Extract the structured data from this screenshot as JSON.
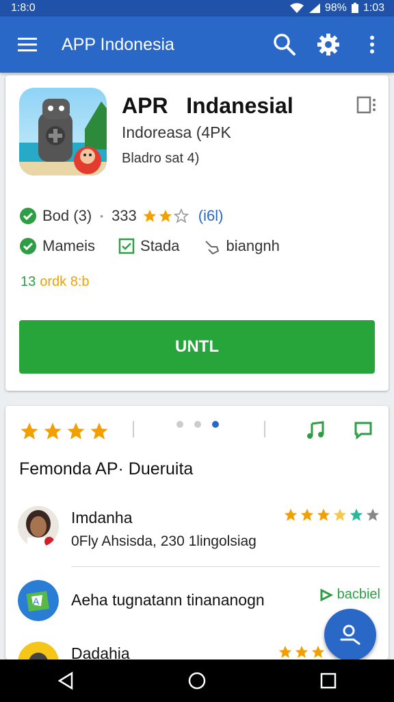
{
  "status": {
    "time": "1:8:0",
    "battery": "98%",
    "clock": "1:03"
  },
  "app_bar": {
    "title": "APP Indonesia"
  },
  "app": {
    "name": "APR   Indanesial",
    "subtitle": "Indoreasa  (4PK",
    "meta": "Bladro sat 4)",
    "info_a": "Bod (3)",
    "rating_value": "333",
    "rating_count": "(i6l)",
    "info_b": "Mameis",
    "info_c": "Stada",
    "info_d": "biangnh",
    "size_green": "13",
    "size_orange": "ordk 8:b",
    "install_label": "UNTL"
  },
  "reviews": {
    "heading": "Femonda AP· Dueruita",
    "items": [
      {
        "name": "Imdanha",
        "text": "0Fly Ahsisda, 230  1lingolsiag"
      },
      {
        "name": "Aeha tugnatann tinananogn",
        "tag": "bacbiel"
      },
      {
        "name": "Dadahia"
      }
    ]
  },
  "colors": {
    "primary": "#2a68c8",
    "install": "#27a43a",
    "star": "#f2a000",
    "check": "#2e9e44"
  },
  "icons": [
    "menu-icon",
    "search-icon",
    "settings-icon",
    "more-vert-icon",
    "wishlist-icon",
    "check-icon",
    "star-icon",
    "music-note-icon",
    "chat-bubble-icon",
    "person-search-icon",
    "back-icon",
    "home-icon",
    "recents-icon"
  ]
}
